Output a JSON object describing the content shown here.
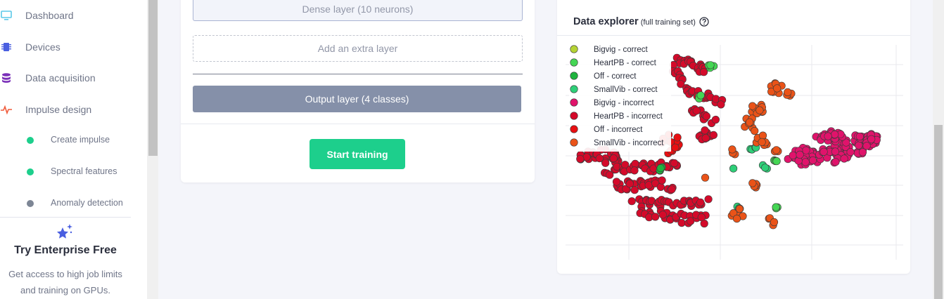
{
  "sidebar": {
    "items": [
      {
        "label": "Dashboard",
        "icon": "monitor-icon"
      },
      {
        "label": "Devices",
        "icon": "chip-icon"
      },
      {
        "label": "Data acquisition",
        "icon": "database-icon"
      },
      {
        "label": "Impulse design",
        "icon": "pulse-icon"
      }
    ],
    "subitems": [
      {
        "label": "Create impulse",
        "status_color": "#1dcf8c"
      },
      {
        "label": "Spectral features",
        "status_color": "#1dcf8c"
      },
      {
        "label": "Anomaly detection",
        "status_color": "#7d8695"
      }
    ],
    "promo": {
      "title": "Try Enterprise Free",
      "text_line1": "Get access to high job limits",
      "text_line2": "and training on GPUs."
    }
  },
  "training": {
    "dense_layer": "Dense layer (10 neurons)",
    "add_layer": "Add an extra layer",
    "output_layer": "Output layer (4 classes)",
    "start_button": "Start training"
  },
  "explorer": {
    "title": "Data explorer",
    "subtitle": "(full training set)"
  },
  "chart_data": {
    "type": "scatter",
    "legend_placement": "top-left",
    "grid": true,
    "series": [
      {
        "name": "Bigvig - correct",
        "color": "#b5d334"
      },
      {
        "name": "HeartPB - correct",
        "color": "#45d654"
      },
      {
        "name": "Off - correct",
        "color": "#1fb43e"
      },
      {
        "name": "SmallVib - correct",
        "color": "#2ecf78"
      },
      {
        "name": "Bigvig - incorrect",
        "color": "#e0136b"
      },
      {
        "name": "HeartPB - incorrect",
        "color": "#d40a2a"
      },
      {
        "name": "Off - incorrect",
        "color": "#e80f12"
      },
      {
        "name": "SmallVib - incorrect",
        "color": "#ea5318"
      }
    ]
  }
}
